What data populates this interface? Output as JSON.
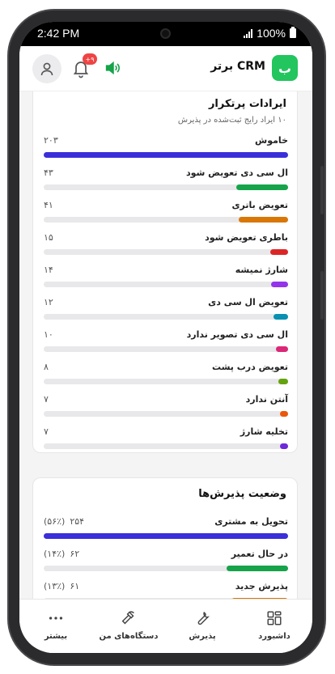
{
  "status_bar": {
    "time": "2:42 PM",
    "battery": "100%"
  },
  "header": {
    "logo_letter": "ب",
    "title": "برتر CRM",
    "notification_badge": "+۹"
  },
  "colors": {
    "brand": "#22c55e",
    "badge": "#ef4444"
  },
  "icons": [
    "user-icon",
    "bell-icon",
    "speaker-icon",
    "dashboard-icon",
    "wrench-icon",
    "hammer-icon",
    "more-icon"
  ],
  "issues_card": {
    "title": "ایرادات پرتکرار",
    "subtitle": "۱۰ ایراد رایج ثبت‌شده در پذیرش",
    "items": [
      {
        "label": "خاموش",
        "count": "۲۰۳",
        "value": 203,
        "color": "#3b2fd9"
      },
      {
        "label": "ال سی دی تعویض شود",
        "count": "۴۳",
        "value": 43,
        "color": "#16a34a"
      },
      {
        "label": "تعویض باتری",
        "count": "۴۱",
        "value": 41,
        "color": "#d97706"
      },
      {
        "label": "باطری تعویض شود",
        "count": "۱۵",
        "value": 15,
        "color": "#dc2626"
      },
      {
        "label": "شارژ نمیشه",
        "count": "۱۴",
        "value": 14,
        "color": "#9333ea"
      },
      {
        "label": "تعویض ال سی دی",
        "count": "۱۲",
        "value": 12,
        "color": "#0891b2"
      },
      {
        "label": "ال سی دی تصویر ندارد",
        "count": "۱۰",
        "value": 10,
        "color": "#db2777"
      },
      {
        "label": "تعویض درب پشت",
        "count": "۸",
        "value": 8,
        "color": "#65a30d"
      },
      {
        "label": "آنتن ندارد",
        "count": "۷",
        "value": 7,
        "color": "#ea580c"
      },
      {
        "label": "تخلیه شارژ",
        "count": "۷",
        "value": 7,
        "color": "#6d28d9"
      }
    ]
  },
  "status_card": {
    "title": "وضعیت پذیرش‌ها",
    "items": [
      {
        "label": "تحویل به مشتری",
        "count": "۲۵۴",
        "pct": "(۵۶٪)",
        "value": 56,
        "color": "#3b2fd9"
      },
      {
        "label": "در حال تعمیر",
        "count": "۶۲",
        "pct": "(۱۴٪)",
        "value": 14,
        "color": "#16a34a"
      },
      {
        "label": "پذیرش جدید",
        "count": "۶۱",
        "pct": "(۱۳٪)",
        "value": 13,
        "color": "#d97706"
      }
    ]
  },
  "bottom_nav": [
    {
      "label": "داشبورد",
      "icon": "dashboard-icon"
    },
    {
      "label": "پذیرش",
      "icon": "wrench-icon"
    },
    {
      "label": "دستگاه‌های من",
      "icon": "hammer-icon"
    },
    {
      "label": "بیشتر",
      "icon": "more-icon"
    }
  ]
}
